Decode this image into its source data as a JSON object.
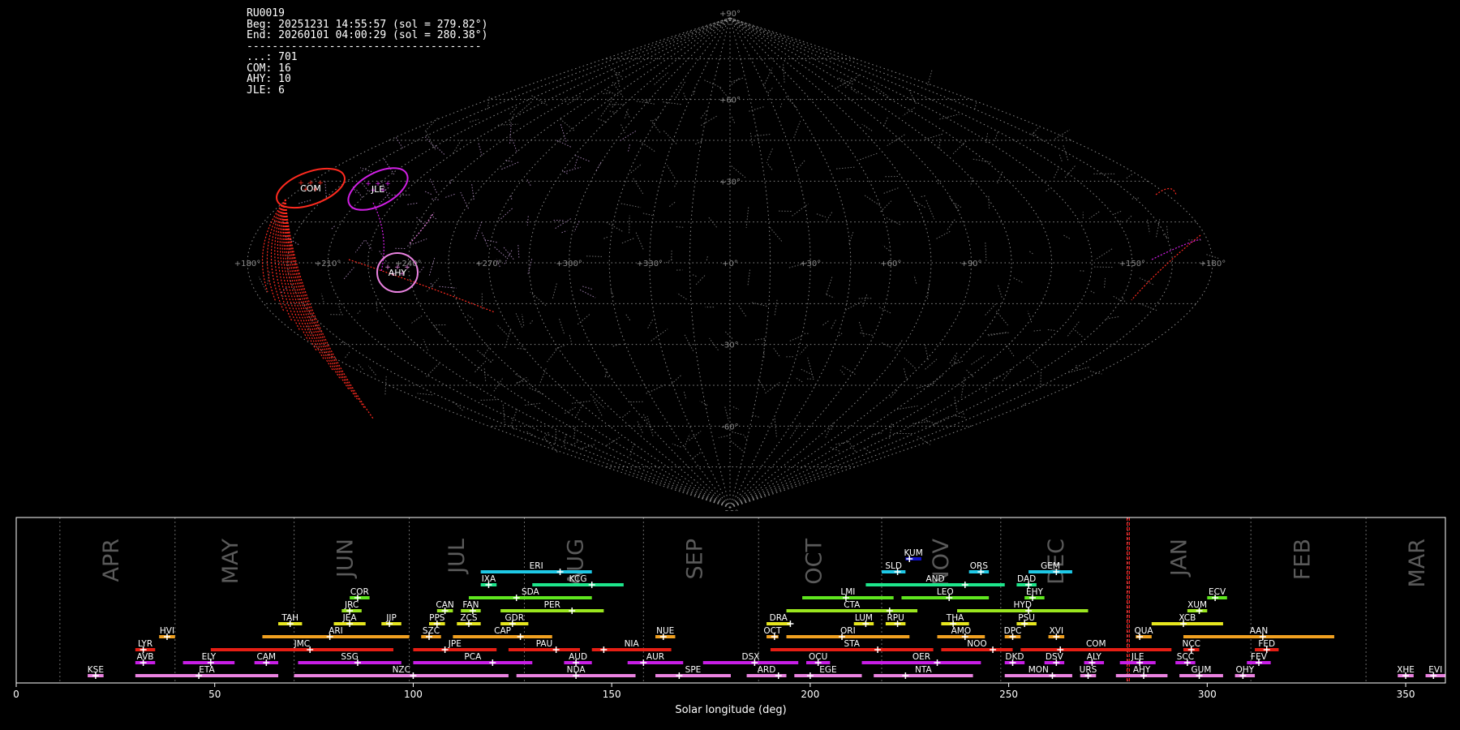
{
  "info": {
    "station": "RU0019",
    "beg": "Beg: 20251231 14:55:57 (sol = 279.82°)",
    "end": "End: 20260101 04:00:29 (sol = 280.38°)",
    "separator": "-------------------------------------",
    "counts": [
      {
        "label": "...",
        "value": 701
      },
      {
        "label": "COM",
        "value": 16
      },
      {
        "label": "AHY",
        "value": 10
      },
      {
        "label": "JLE",
        "value": 6
      }
    ]
  },
  "sky_map": {
    "projection": "sinusoidal",
    "lat_labels": [
      "+90°",
      "+60°",
      "+30°",
      "-30°",
      "-60°",
      "-90°"
    ],
    "lon_labels": [
      "+180°",
      "+150°",
      "+90°",
      "+60°",
      "+30°",
      "+0°",
      "+330°",
      "+300°",
      "+270°",
      "+240°",
      "+210°",
      "+180°"
    ],
    "radiants": [
      {
        "code": "COM",
        "color": "#ff2a1f"
      },
      {
        "code": "JLE",
        "color": "#d21fe6"
      },
      {
        "code": "AHY",
        "color": "#ea82e0"
      }
    ]
  },
  "chart_data": {
    "type": "timeline",
    "xlabel": "Solar longitude (deg)",
    "xlim": [
      0,
      360
    ],
    "xticks": [
      0,
      50,
      100,
      150,
      200,
      250,
      300,
      350
    ],
    "current_sol_range": [
      279.82,
      280.38
    ],
    "months": [
      {
        "name": "APR",
        "start": 11,
        "label": 24
      },
      {
        "name": "MAY",
        "start": 40,
        "label": 54
      },
      {
        "name": "JUN",
        "start": 70,
        "label": 83
      },
      {
        "name": "JUL",
        "start": 99,
        "label": 111
      },
      {
        "name": "AUG",
        "start": 128,
        "label": 141
      },
      {
        "name": "SEP",
        "start": 158,
        "label": 171
      },
      {
        "name": "OCT",
        "start": 187,
        "label": 201
      },
      {
        "name": "NOV",
        "start": 218,
        "label": 233
      },
      {
        "name": "DEC",
        "start": 248,
        "label": 262
      },
      {
        "name": "JAN",
        "start": 280,
        "label": 293
      },
      {
        "name": "FEB",
        "start": 311,
        "label": 324
      },
      {
        "name": "MAR",
        "start": 340,
        "label": 353
      }
    ],
    "showers": [
      {
        "code": "KUM",
        "start": 224,
        "end": 228,
        "peak": 225,
        "row": 10,
        "color": "#1010c8"
      },
      {
        "code": "ERI",
        "start": 117,
        "end": 145,
        "peak": 137,
        "row": 9,
        "color": "#1ec8e6"
      },
      {
        "code": "SLD",
        "start": 218,
        "end": 224,
        "peak": 222,
        "row": 9,
        "color": "#1ec8e6"
      },
      {
        "code": "ORS",
        "start": 240,
        "end": 245,
        "peak": 243,
        "row": 9,
        "color": "#1ec8e6"
      },
      {
        "code": "GEM",
        "start": 255,
        "end": 266,
        "peak": 262,
        "row": 9,
        "color": "#1ec8e6"
      },
      {
        "code": "IXA",
        "start": 117,
        "end": 121,
        "peak": 119,
        "row": 8,
        "color": "#1ee68c"
      },
      {
        "code": "KCG",
        "start": 130,
        "end": 153,
        "peak": 145,
        "row": 8,
        "color": "#1ee68c"
      },
      {
        "code": "AND",
        "start": 214,
        "end": 249,
        "peak": 239,
        "row": 8,
        "color": "#1ee68c"
      },
      {
        "code": "DAD",
        "start": 252,
        "end": 257,
        "peak": 255,
        "row": 8,
        "color": "#1ee68c"
      },
      {
        "code": "COR",
        "start": 84,
        "end": 89,
        "peak": 86,
        "row": 7,
        "color": "#5fe61e"
      },
      {
        "code": "SDA",
        "start": 114,
        "end": 145,
        "peak": 126,
        "row": 7,
        "color": "#5fe61e"
      },
      {
        "code": "LMI",
        "start": 198,
        "end": 221,
        "peak": 209,
        "row": 7,
        "color": "#5fe61e"
      },
      {
        "code": "LEO",
        "start": 223,
        "end": 245,
        "peak": 235,
        "row": 7,
        "color": "#5fe61e"
      },
      {
        "code": "EHY",
        "start": 254,
        "end": 259,
        "peak": 256,
        "row": 7,
        "color": "#5fe61e"
      },
      {
        "code": "ECV",
        "start": 300,
        "end": 305,
        "peak": 302,
        "row": 7,
        "color": "#5fe61e"
      },
      {
        "code": "JRC",
        "start": 82,
        "end": 87,
        "peak": 84,
        "row": 6,
        "color": "#9ae61e"
      },
      {
        "code": "CAN",
        "start": 106,
        "end": 110,
        "peak": 108,
        "row": 6,
        "color": "#9ae61e"
      },
      {
        "code": "FAN",
        "start": 112,
        "end": 117,
        "peak": 115,
        "row": 6,
        "color": "#9ae61e"
      },
      {
        "code": "PER",
        "start": 122,
        "end": 148,
        "peak": 140,
        "row": 6,
        "color": "#9ae61e"
      },
      {
        "code": "CTA",
        "start": 194,
        "end": 227,
        "peak": 220,
        "row": 6,
        "color": "#9ae61e"
      },
      {
        "code": "HYD",
        "start": 237,
        "end": 270,
        "peak": 255,
        "row": 6,
        "color": "#9ae61e"
      },
      {
        "code": "XUM",
        "start": 295,
        "end": 300,
        "peak": 298,
        "row": 6,
        "color": "#9ae61e"
      },
      {
        "code": "TAH",
        "start": 66,
        "end": 72,
        "peak": 69,
        "row": 5,
        "color": "#e6e61e"
      },
      {
        "code": "JEA",
        "start": 80,
        "end": 88,
        "peak": 84,
        "row": 5,
        "color": "#e6e61e"
      },
      {
        "code": "JIP",
        "start": 92,
        "end": 97,
        "peak": 94,
        "row": 5,
        "color": "#e6e61e"
      },
      {
        "code": "PPS",
        "start": 104,
        "end": 108,
        "peak": 106,
        "row": 5,
        "color": "#e6e61e"
      },
      {
        "code": "ZCS",
        "start": 111,
        "end": 117,
        "peak": 114,
        "row": 5,
        "color": "#e6e61e"
      },
      {
        "code": "GDR",
        "start": 122,
        "end": 129,
        "peak": 125,
        "row": 5,
        "color": "#e6e61e"
      },
      {
        "code": "DRA",
        "start": 189,
        "end": 195,
        "peak": 195,
        "row": 5,
        "color": "#e6e61e"
      },
      {
        "code": "LUM",
        "start": 211,
        "end": 216,
        "peak": 214,
        "row": 5,
        "color": "#e6e61e"
      },
      {
        "code": "RPU",
        "start": 219,
        "end": 224,
        "peak": 222,
        "row": 5,
        "color": "#e6e61e"
      },
      {
        "code": "THA",
        "start": 233,
        "end": 240,
        "peak": 236,
        "row": 5,
        "color": "#e6e61e"
      },
      {
        "code": "PSU",
        "start": 252,
        "end": 257,
        "peak": 254,
        "row": 5,
        "color": "#e6e61e"
      },
      {
        "code": "XCB",
        "start": 286,
        "end": 304,
        "peak": 294,
        "row": 5,
        "color": "#e6e61e"
      },
      {
        "code": "HVI",
        "start": 36,
        "end": 40,
        "peak": 38,
        "row": 4,
        "color": "#f0a020"
      },
      {
        "code": "ARI",
        "start": 62,
        "end": 99,
        "peak": 79,
        "row": 4,
        "color": "#f0a020"
      },
      {
        "code": "SZC",
        "start": 102,
        "end": 107,
        "peak": 104,
        "row": 4,
        "color": "#f0a020"
      },
      {
        "code": "CAP",
        "start": 110,
        "end": 135,
        "peak": 127,
        "row": 4,
        "color": "#f0a020"
      },
      {
        "code": "NUE",
        "start": 161,
        "end": 166,
        "peak": 163,
        "row": 4,
        "color": "#f0a020"
      },
      {
        "code": "OCT",
        "start": 189,
        "end": 192,
        "peak": 191,
        "row": 4,
        "color": "#f0a020"
      },
      {
        "code": "ORI",
        "start": 194,
        "end": 225,
        "peak": 208,
        "row": 4,
        "color": "#f0a020"
      },
      {
        "code": "AMO",
        "start": 232,
        "end": 244,
        "peak": 239,
        "row": 4,
        "color": "#f0a020"
      },
      {
        "code": "DPC",
        "start": 249,
        "end": 253,
        "peak": 251,
        "row": 4,
        "color": "#f0a020"
      },
      {
        "code": "XVI",
        "start": 260,
        "end": 264,
        "peak": 262,
        "row": 4,
        "color": "#f0a020"
      },
      {
        "code": "QUA",
        "start": 282,
        "end": 286,
        "peak": 283,
        "row": 4,
        "color": "#f0a020"
      },
      {
        "code": "AAN",
        "start": 294,
        "end": 332,
        "peak": 314,
        "row": 4,
        "color": "#f0a020"
      },
      {
        "code": "LYR",
        "start": 30,
        "end": 35,
        "peak": 32,
        "row": 3,
        "color": "#e61e14"
      },
      {
        "code": "JMC",
        "start": 49,
        "end": 95,
        "peak": 74,
        "row": 3,
        "color": "#e61e14"
      },
      {
        "code": "JPE",
        "start": 100,
        "end": 121,
        "peak": 108,
        "row": 3,
        "color": "#e61e14"
      },
      {
        "code": "PAU",
        "start": 124,
        "end": 142,
        "peak": 136,
        "row": 3,
        "color": "#e61e14"
      },
      {
        "code": "NIA",
        "start": 145,
        "end": 165,
        "peak": 148,
        "row": 3,
        "color": "#e61e14"
      },
      {
        "code": "STA",
        "start": 190,
        "end": 231,
        "peak": 217,
        "row": 3,
        "color": "#e61e14"
      },
      {
        "code": "NOO",
        "start": 233,
        "end": 251,
        "peak": 246,
        "row": 3,
        "color": "#e61e14"
      },
      {
        "code": "COM",
        "start": 253,
        "end": 291,
        "peak": 263,
        "row": 3,
        "color": "#e61e14"
      },
      {
        "code": "NCC",
        "start": 294,
        "end": 298,
        "peak": 296,
        "row": 3,
        "color": "#e61e14"
      },
      {
        "code": "FED",
        "start": 312,
        "end": 318,
        "peak": 315,
        "row": 3,
        "color": "#e61e14"
      },
      {
        "code": "AVB",
        "start": 30,
        "end": 35,
        "peak": 32,
        "row": 2,
        "color": "#c81ee6"
      },
      {
        "code": "ELY",
        "start": 42,
        "end": 55,
        "peak": 49,
        "row": 2,
        "color": "#c81ee6"
      },
      {
        "code": "CAM",
        "start": 60,
        "end": 66,
        "peak": 63,
        "row": 2,
        "color": "#c81ee6"
      },
      {
        "code": "SSG",
        "start": 71,
        "end": 97,
        "peak": 86,
        "row": 2,
        "color": "#c81ee6"
      },
      {
        "code": "PCA",
        "start": 100,
        "end": 130,
        "peak": 120,
        "row": 2,
        "color": "#c81ee6"
      },
      {
        "code": "AUD",
        "start": 138,
        "end": 145,
        "peak": 141,
        "row": 2,
        "color": "#c81ee6"
      },
      {
        "code": "AUR",
        "start": 154,
        "end": 168,
        "peak": 158,
        "row": 2,
        "color": "#c81ee6"
      },
      {
        "code": "DSX",
        "start": 173,
        "end": 197,
        "peak": 186,
        "row": 2,
        "color": "#c81ee6"
      },
      {
        "code": "OCU",
        "start": 199,
        "end": 205,
        "peak": 202,
        "row": 2,
        "color": "#c81ee6"
      },
      {
        "code": "OER",
        "start": 213,
        "end": 243,
        "peak": 232,
        "row": 2,
        "color": "#c81ee6"
      },
      {
        "code": "DKD",
        "start": 249,
        "end": 254,
        "peak": 251,
        "row": 2,
        "color": "#c81ee6"
      },
      {
        "code": "DSV",
        "start": 259,
        "end": 264,
        "peak": 262,
        "row": 2,
        "color": "#c81ee6"
      },
      {
        "code": "ALY",
        "start": 269,
        "end": 274,
        "peak": 271,
        "row": 2,
        "color": "#c81ee6"
      },
      {
        "code": "JLE",
        "start": 278,
        "end": 287,
        "peak": 283,
        "row": 2,
        "color": "#c81ee6"
      },
      {
        "code": "SCC",
        "start": 292,
        "end": 297,
        "peak": 295,
        "row": 2,
        "color": "#c81ee6"
      },
      {
        "code": "FEV",
        "start": 310,
        "end": 316,
        "peak": 313,
        "row": 2,
        "color": "#c81ee6"
      },
      {
        "code": "KSE",
        "start": 18,
        "end": 22,
        "peak": 20,
        "row": 1,
        "color": "#ea82e0"
      },
      {
        "code": "ETA",
        "start": 30,
        "end": 66,
        "peak": 46,
        "row": 1,
        "color": "#ea82e0"
      },
      {
        "code": "NZC",
        "start": 70,
        "end": 124,
        "peak": 100,
        "row": 1,
        "color": "#ea82e0"
      },
      {
        "code": "NDA",
        "start": 126,
        "end": 156,
        "peak": 141,
        "row": 1,
        "color": "#ea82e0"
      },
      {
        "code": "SPE",
        "start": 161,
        "end": 180,
        "peak": 167,
        "row": 1,
        "color": "#ea82e0"
      },
      {
        "code": "ARD",
        "start": 184,
        "end": 194,
        "peak": 192,
        "row": 1,
        "color": "#ea82e0"
      },
      {
        "code": "EGE",
        "start": 196,
        "end": 213,
        "peak": 200,
        "row": 1,
        "color": "#ea82e0"
      },
      {
        "code": "NTA",
        "start": 216,
        "end": 241,
        "peak": 224,
        "row": 1,
        "color": "#ea82e0"
      },
      {
        "code": "MON",
        "start": 249,
        "end": 266,
        "peak": 261,
        "row": 1,
        "color": "#ea82e0"
      },
      {
        "code": "URS",
        "start": 268,
        "end": 272,
        "peak": 270,
        "row": 1,
        "color": "#ea82e0"
      },
      {
        "code": "AHY",
        "start": 277,
        "end": 290,
        "peak": 284,
        "row": 1,
        "color": "#ea82e0"
      },
      {
        "code": "GUM",
        "start": 293,
        "end": 304,
        "peak": 298,
        "row": 1,
        "color": "#ea82e0"
      },
      {
        "code": "OHY",
        "start": 307,
        "end": 312,
        "peak": 309,
        "row": 1,
        "color": "#ea82e0"
      },
      {
        "code": "XHE",
        "start": 348,
        "end": 352,
        "peak": 350,
        "row": 1,
        "color": "#ea82e0"
      },
      {
        "code": "EVI",
        "start": 355,
        "end": 360,
        "peak": 357,
        "row": 1,
        "color": "#ea82e0"
      }
    ]
  }
}
